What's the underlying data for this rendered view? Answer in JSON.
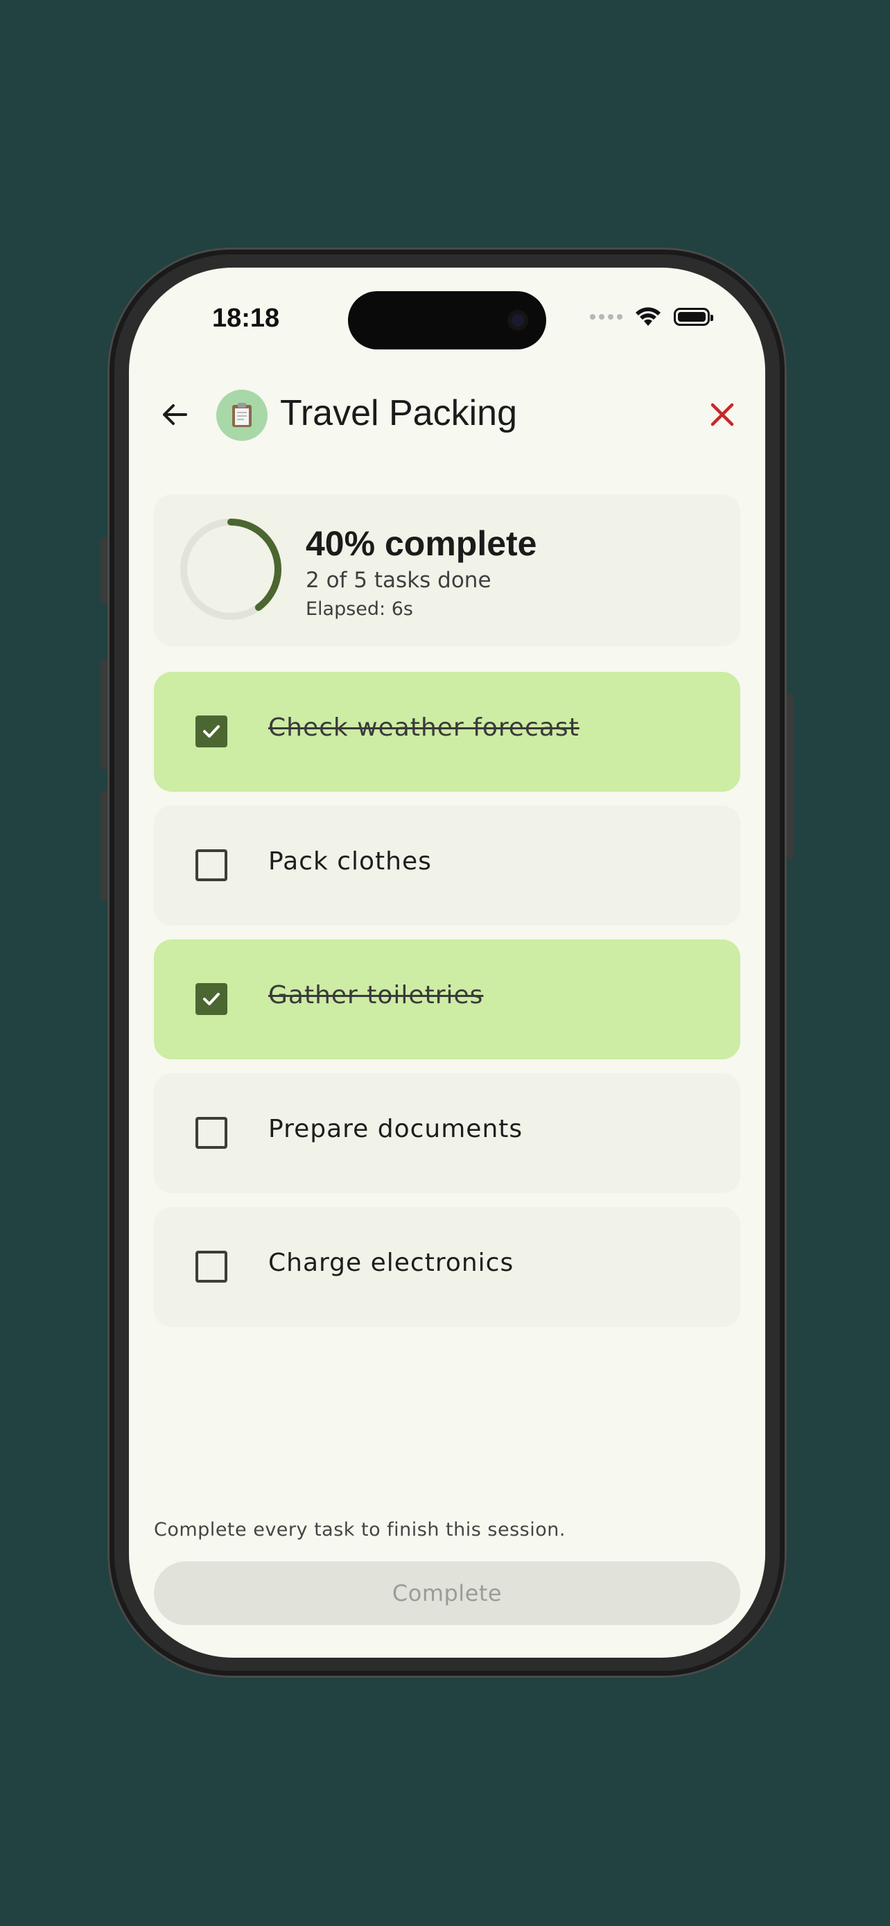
{
  "status_bar": {
    "time": "18:18"
  },
  "header": {
    "title": "Travel Packing",
    "back_icon": "arrow-left-icon",
    "list_icon": "clipboard-icon",
    "close_icon": "close-icon",
    "close_color": "#c62828"
  },
  "progress": {
    "percent_label": "40% complete",
    "fraction": 0.4,
    "tasks_done_label": "2 of 5 tasks done",
    "elapsed_label": "Elapsed: 6s",
    "ring_color": "#4b6630",
    "track_color": "#e2e3da"
  },
  "tasks": [
    {
      "label": "Check weather forecast",
      "done": true
    },
    {
      "label": "Pack clothes",
      "done": false
    },
    {
      "label": "Gather toiletries",
      "done": true
    },
    {
      "label": "Prepare documents",
      "done": false
    },
    {
      "label": "Charge electronics",
      "done": false
    }
  ],
  "footer": {
    "hint": "Complete every task to finish this session.",
    "complete_label": "Complete"
  }
}
